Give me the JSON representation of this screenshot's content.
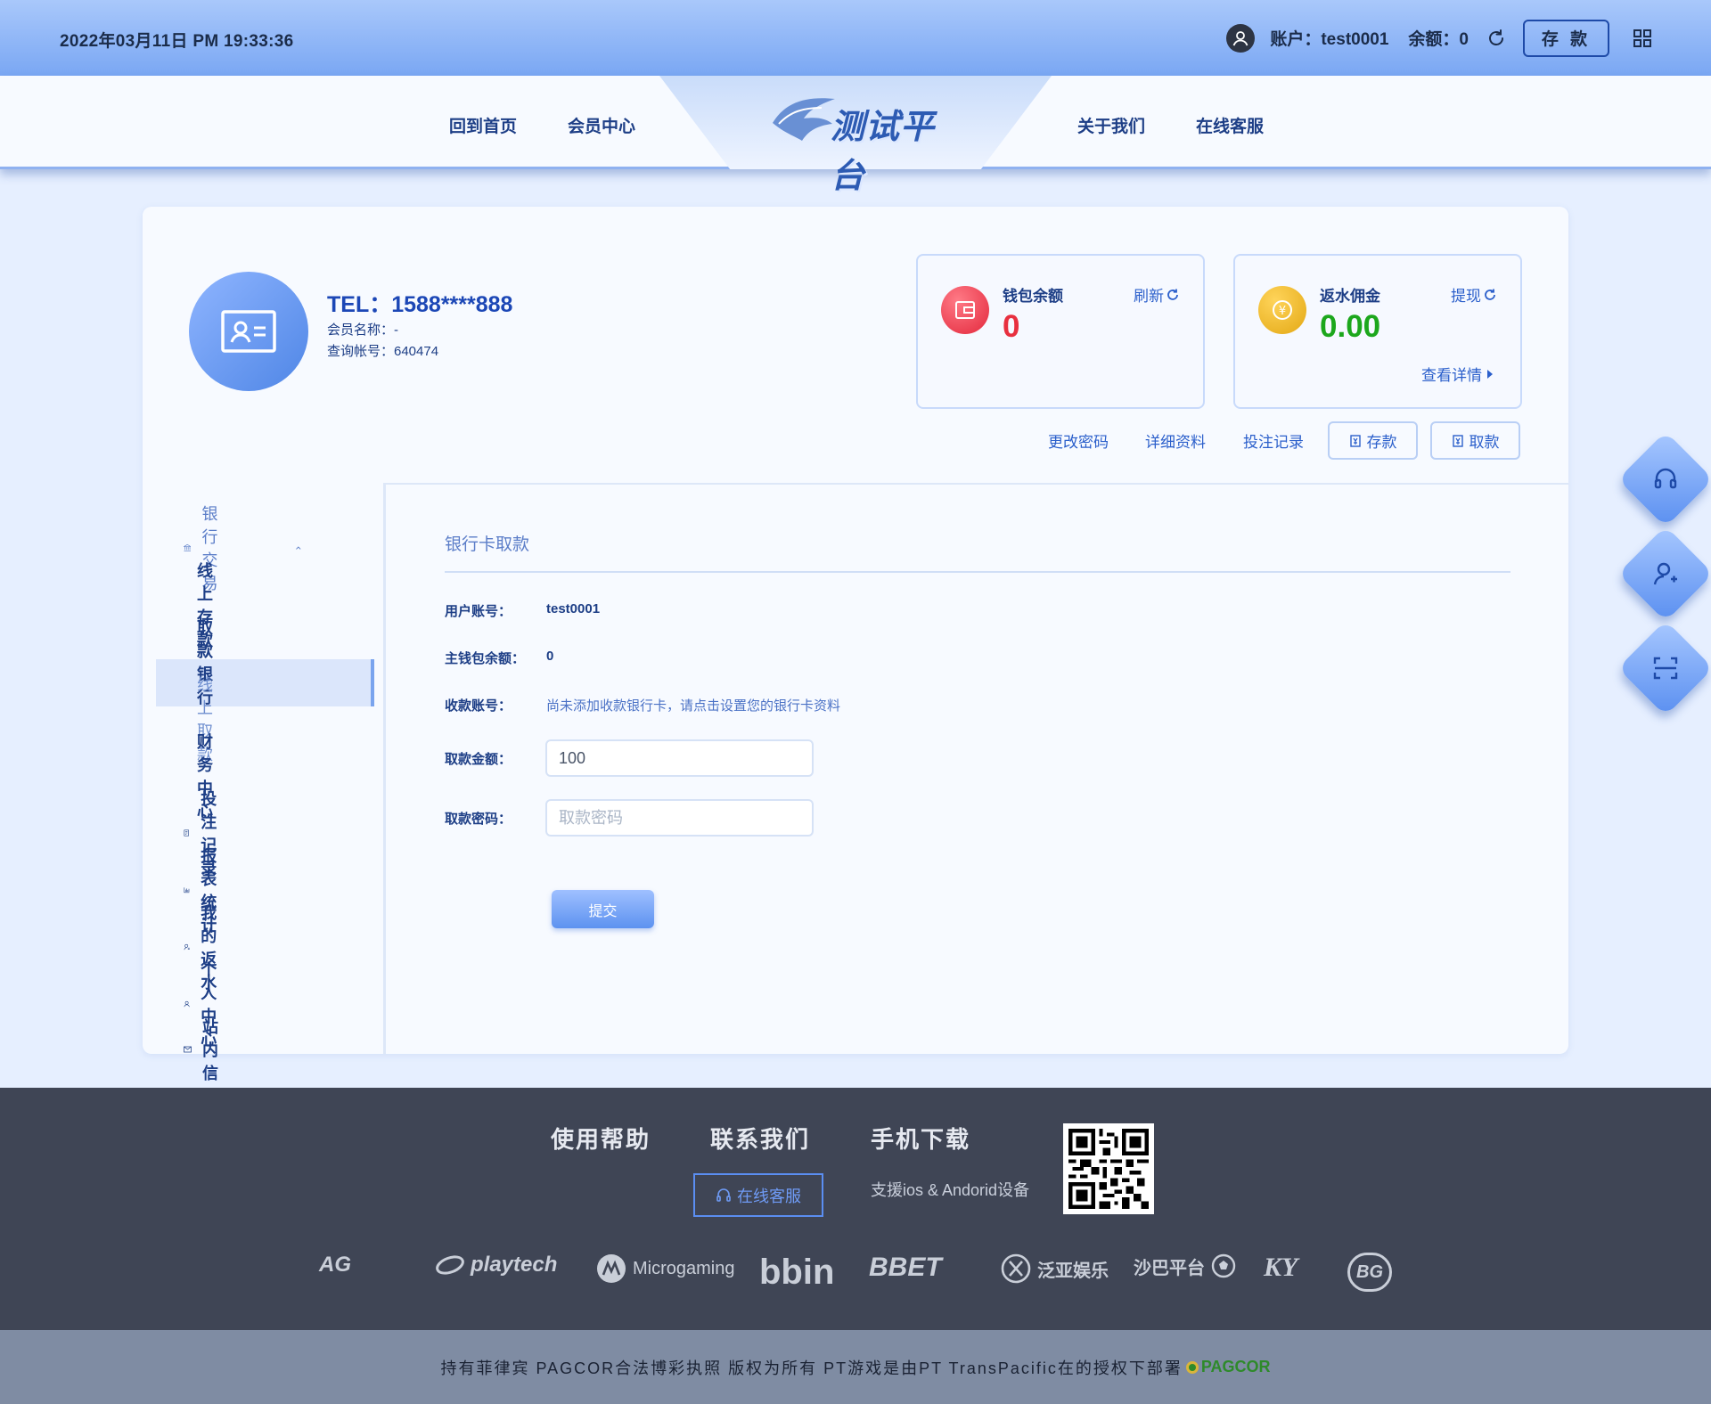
{
  "header": {
    "datetime": "2022年03月11日 PM 19:33:36",
    "account": "账户：test0001",
    "balance": "余额：0",
    "deposit_label": "存 款"
  },
  "nav": {
    "home": "回到首页",
    "member_center": "会员中心",
    "logo_text": "测试平台",
    "about": "关于我们",
    "support": "在线客服"
  },
  "profile": {
    "tel": "TEL：1588****888",
    "member_name": "会员名称：-",
    "query_account": "查询帐号：640474"
  },
  "wallet": {
    "label": "钱包余额",
    "value": "0",
    "action": "刷新",
    "value_color": "#e8303f"
  },
  "rebate": {
    "label": "返水佣金",
    "value": "0.00",
    "action": "提现",
    "details": "查看详情",
    "value_color": "#1ca71c"
  },
  "quick_links": {
    "change_password": "更改密码",
    "details": "详细资料",
    "bet_records": "投注记录",
    "deposit": "存款",
    "withdraw": "取款"
  },
  "sidebar": {
    "group": "银行交易",
    "items": [
      {
        "label": "线上存款"
      },
      {
        "label": "取款银行"
      },
      {
        "label": "线上取款"
      },
      {
        "label": "财务中心"
      },
      {
        "label": "投注记录"
      },
      {
        "label": "报表统计"
      },
      {
        "label": "我的返水"
      },
      {
        "label": "个人中心"
      },
      {
        "label": "站内信"
      }
    ]
  },
  "form": {
    "title": "银行卡取款",
    "username_label": "用户账号：",
    "username_value": "test0001",
    "main_wallet_label": "主钱包余额：",
    "main_wallet_value": "0",
    "receive_label": "收款账号：",
    "receive_hint": "尚未添加收款银行卡，请点击设置您的银行卡资料",
    "amount_label": "取款金额：",
    "amount_value": "100",
    "password_label": "取款密码：",
    "password_placeholder": "取款密码",
    "submit": "提交"
  },
  "footer": {
    "help": "使用帮助",
    "contact": "联系我们",
    "download": "手机下载",
    "cs_button": "在线客服",
    "support_text": "支援ios & Andorid设备",
    "partners": [
      "AG",
      "playtech",
      "Microgaming",
      "bbin",
      "BBET",
      "泛亚娱乐",
      "沙巴平台",
      "KY",
      "BG"
    ],
    "copyright": "持有菲律宾 PAGCOR合法博彩执照 版权为所有 PT游戏是由PT TransPacific在的授权下部署",
    "pagcor": "PAGCOR"
  }
}
